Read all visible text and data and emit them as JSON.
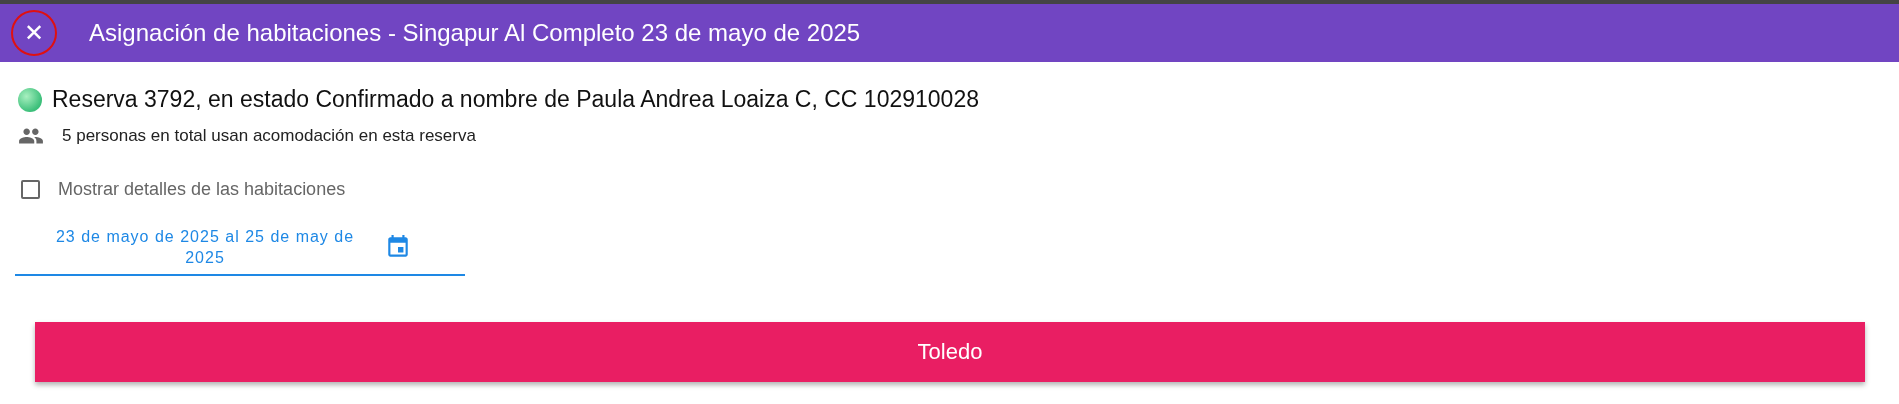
{
  "header": {
    "close_button": "✕",
    "title": "Asignación de habitaciones - Singapur Al Completo 23 de mayo de 2025"
  },
  "reservation": {
    "text": "Reserva 3792, en estado Confirmado a nombre de Paula Andrea Loaiza C, CC 102910028"
  },
  "guests": {
    "text": "5 personas en total usan acomodación en esta reserva"
  },
  "details_checkbox": {
    "label": "Mostrar detalles de las habitaciones",
    "checked": false
  },
  "date_field": {
    "value": "23 de mayo de 2025 al 25 de may de 2025"
  },
  "rooms": [
    {
      "label": "Toledo"
    }
  ]
}
